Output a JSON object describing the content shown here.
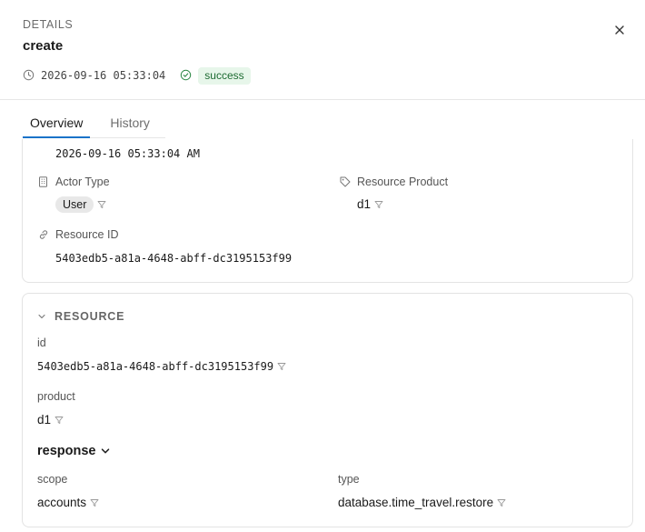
{
  "header": {
    "eyebrow": "DETAILS",
    "title": "create",
    "timestamp": "2026-09-16 05:33:04",
    "status": "success"
  },
  "tabs": [
    {
      "label": "Overview",
      "active": true
    },
    {
      "label": "History",
      "active": false
    }
  ],
  "overview": {
    "timestamp_value": "2026-09-16 05:33:04 AM",
    "actor_type": {
      "label": "Actor Type",
      "value": "User"
    },
    "resource_product": {
      "label": "Resource Product",
      "value": "d1"
    },
    "resource_id": {
      "label": "Resource ID",
      "value": "5403edb5-a81a-4648-abff-dc3195153f99"
    }
  },
  "resource": {
    "heading": "RESOURCE",
    "id": {
      "label": "id",
      "value": "5403edb5-a81a-4648-abff-dc3195153f99"
    },
    "product": {
      "label": "product",
      "value": "d1"
    },
    "response": {
      "heading": "response",
      "scope": {
        "label": "scope",
        "value": "accounts"
      },
      "type": {
        "label": "type",
        "value": "database.time_travel.restore"
      }
    }
  },
  "colors": {
    "accent": "#1a73c9",
    "success_bg": "#e7f6ea",
    "success_text": "#1d6b32"
  },
  "icons": [
    "close-icon",
    "clock-icon",
    "check-circle-icon",
    "building-icon",
    "tag-icon",
    "link-icon",
    "chevron-down-icon",
    "filter-icon"
  ]
}
